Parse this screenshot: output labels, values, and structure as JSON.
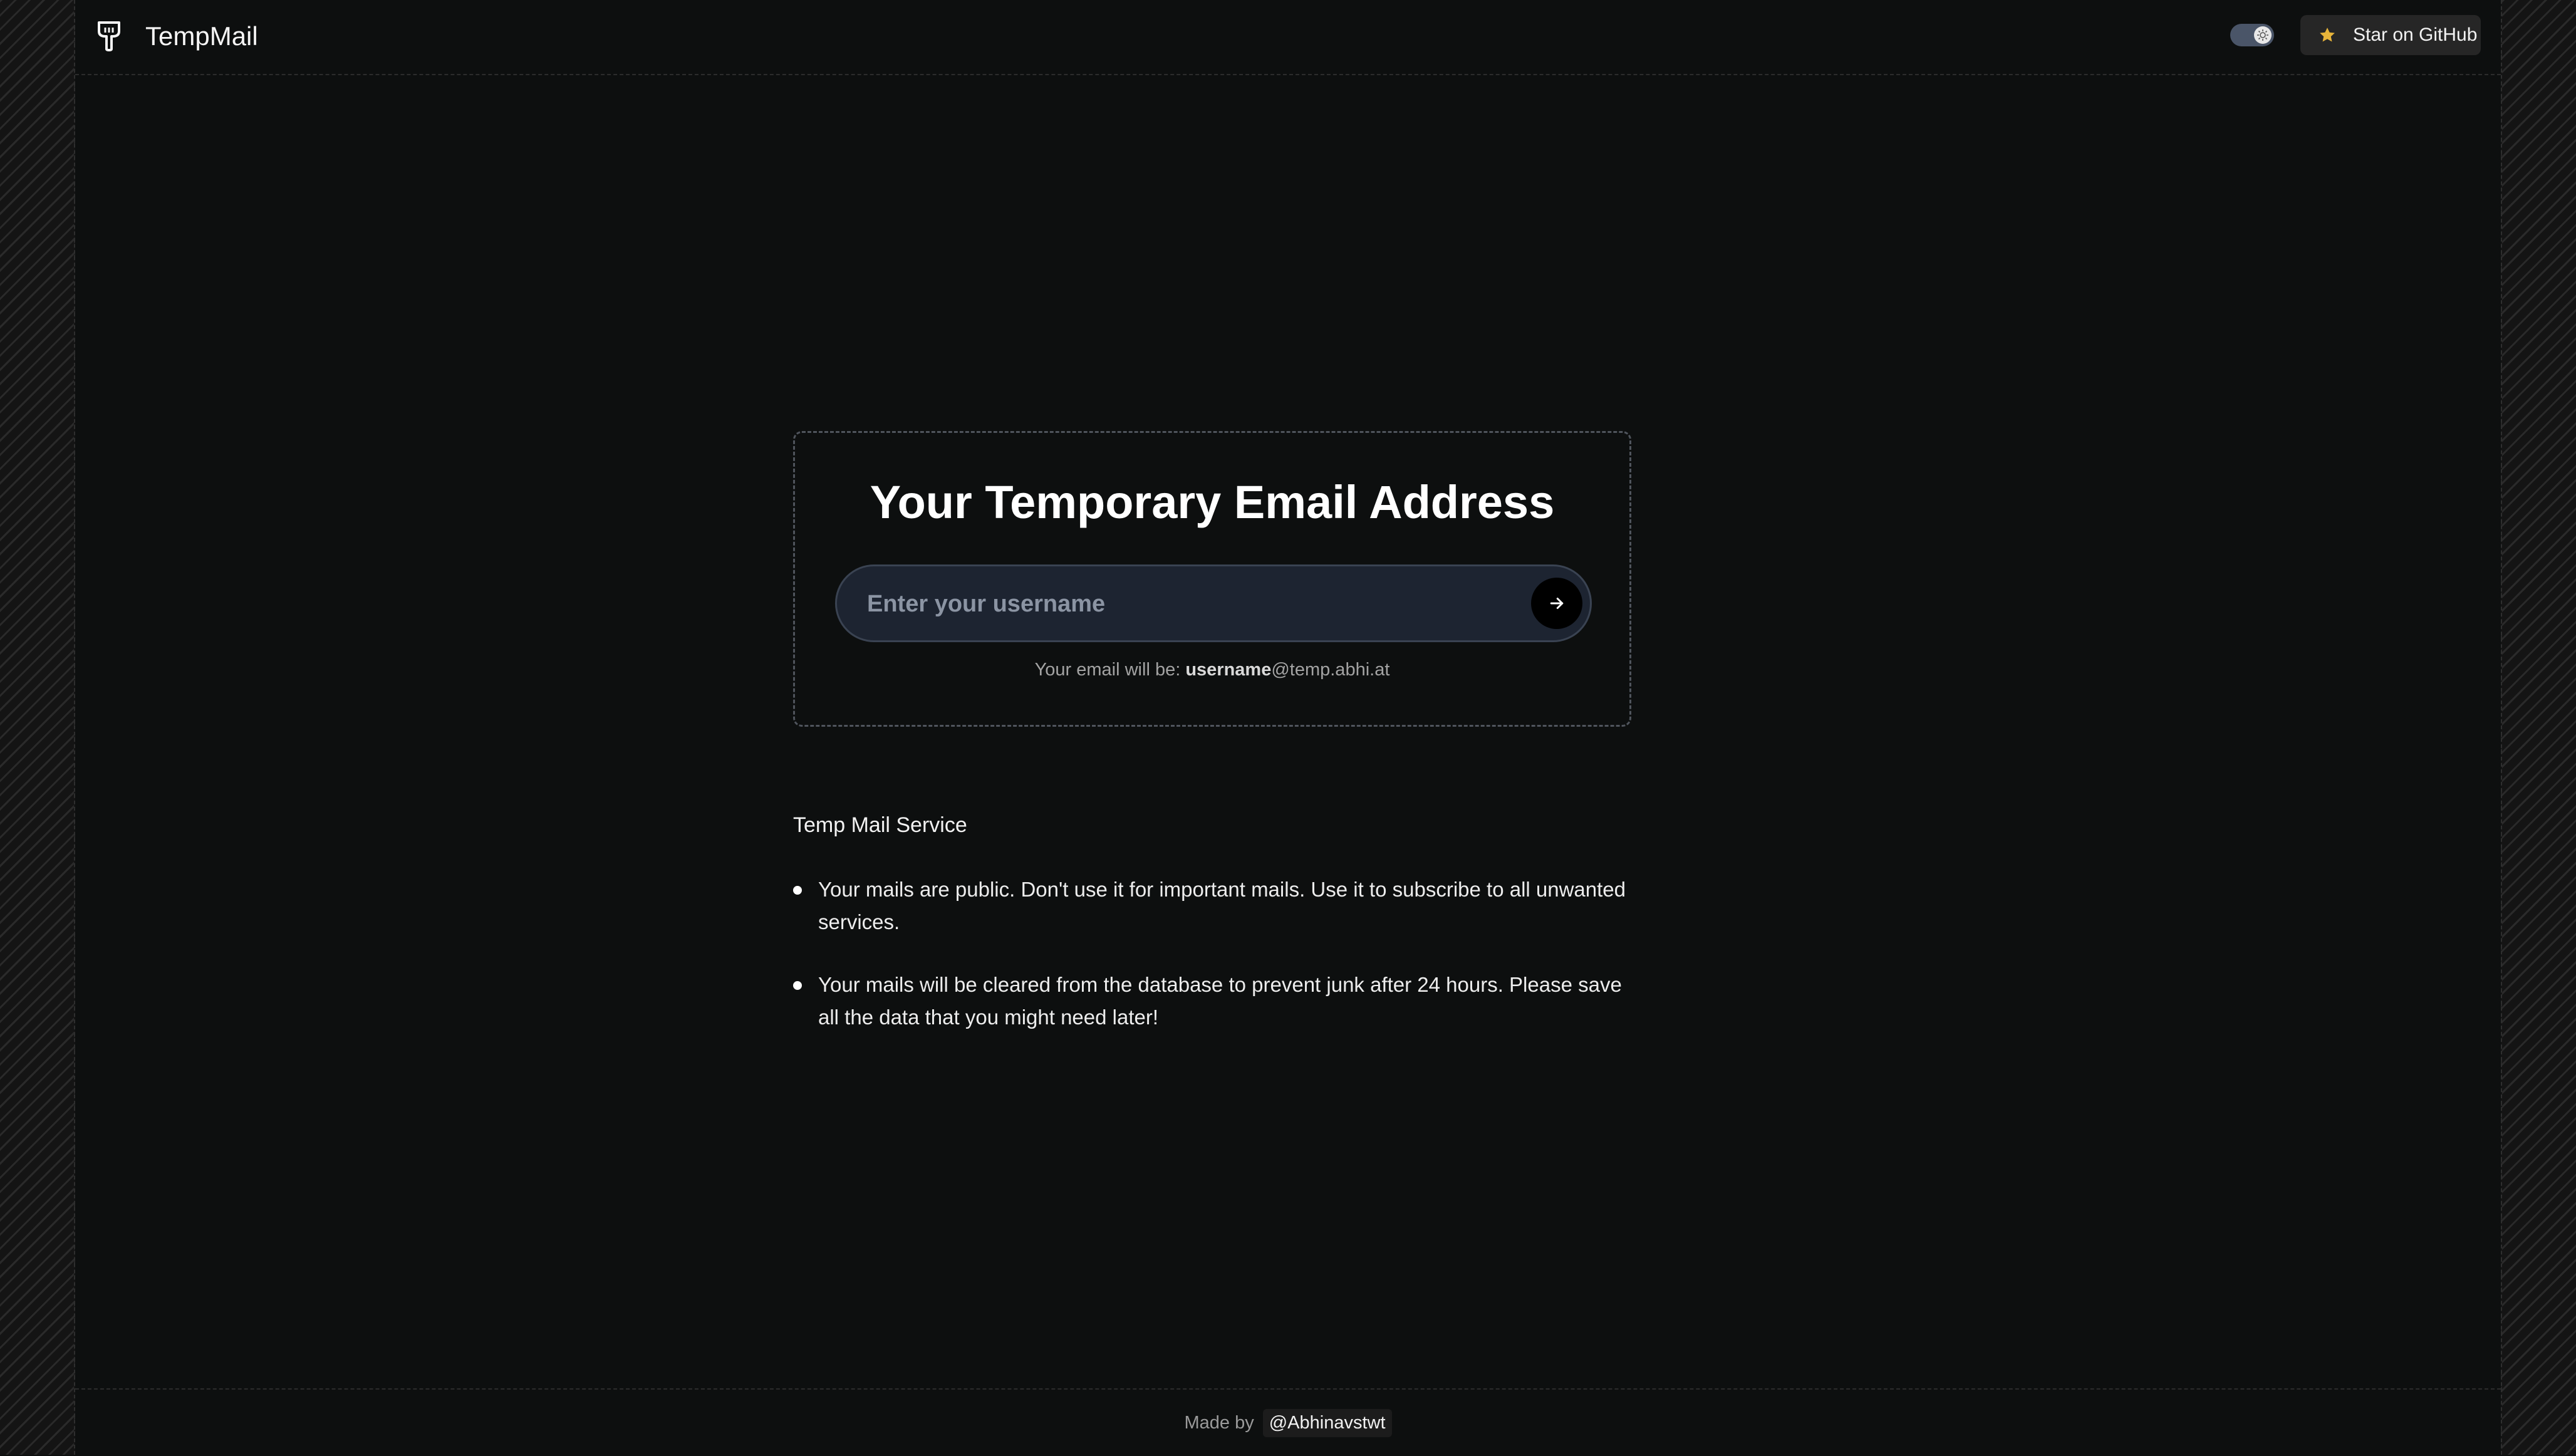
{
  "header": {
    "brand": "TempMail",
    "logo_icon": "tempmail-logo-icon",
    "theme_toggle_icon": "sun-icon",
    "github_button_label": "Star on GitHub",
    "github_icon": "star-icon"
  },
  "card": {
    "title": "Your Temporary Email Address",
    "input_placeholder": "Enter your username",
    "input_value": "",
    "submit_icon": "arrow-right-icon",
    "hint_prefix": "Your email will be: ",
    "hint_username": "username",
    "hint_domain": "@temp.abhi.at"
  },
  "info": {
    "title": "Temp Mail Service",
    "items": [
      "Your mails are public. Don't use it for important mails. Use it to subscribe to all unwanted services.",
      "Your mails will be cleared from the database to prevent junk after 24 hours. Please save all the data that you might need later!"
    ]
  },
  "footer": {
    "made_by": "Made by",
    "author": "@Abhinavstwt"
  },
  "colors": {
    "background": "#0d0f0f",
    "input_bg": "#1d2431",
    "star": "#e7b43a",
    "toggle_track": "#4a5568"
  }
}
